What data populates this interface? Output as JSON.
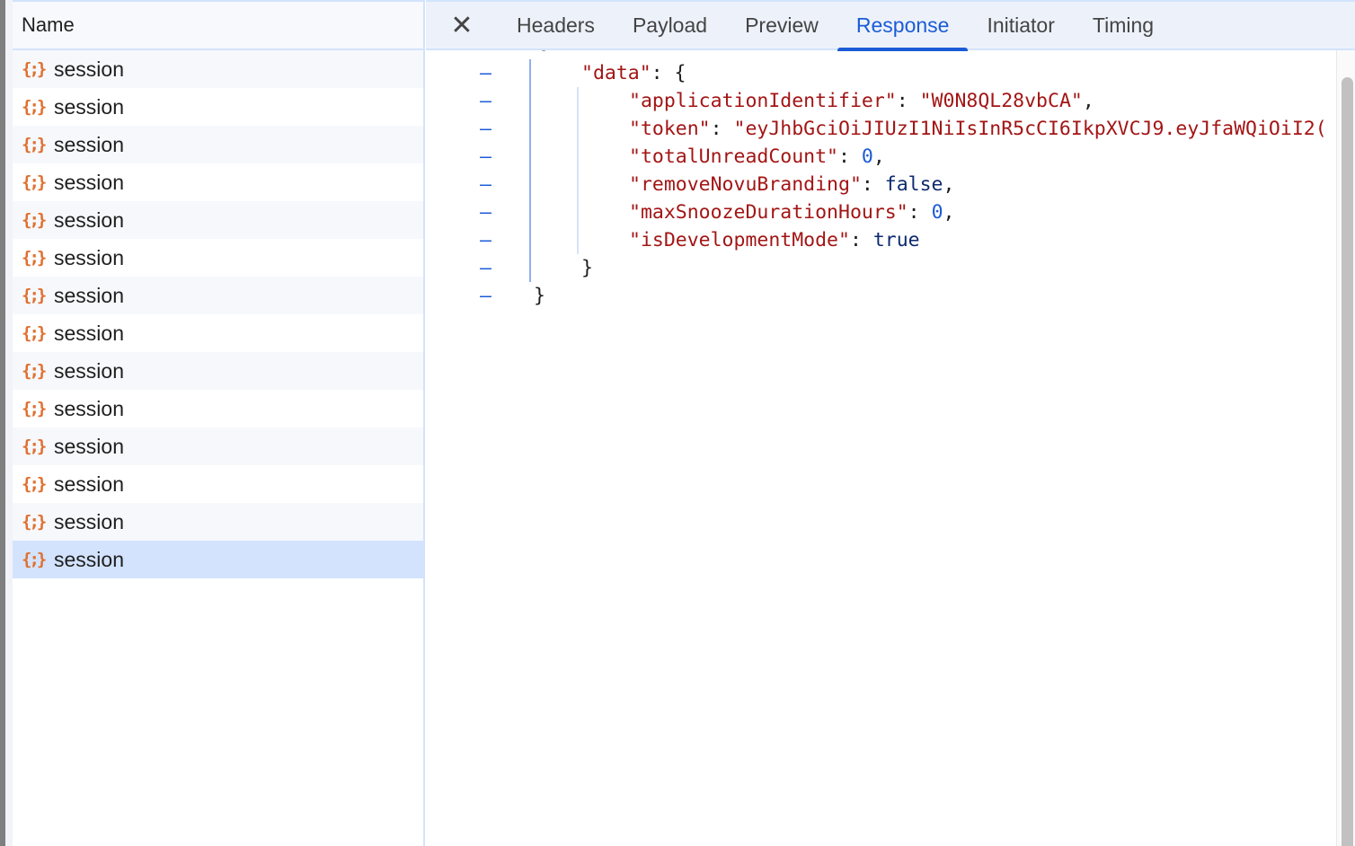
{
  "name_header": "Name",
  "requests": [
    {
      "name": "session"
    },
    {
      "name": "session"
    },
    {
      "name": "session"
    },
    {
      "name": "session"
    },
    {
      "name": "session"
    },
    {
      "name": "session"
    },
    {
      "name": "session"
    },
    {
      "name": "session"
    },
    {
      "name": "session"
    },
    {
      "name": "session"
    },
    {
      "name": "session"
    },
    {
      "name": "session"
    },
    {
      "name": "session"
    },
    {
      "name": "session",
      "selected": true
    }
  ],
  "tabs": [
    "Headers",
    "Payload",
    "Preview",
    "Response",
    "Initiator",
    "Timing"
  ],
  "active_tab": "Response",
  "response": {
    "open_brace": "{",
    "data_key": "\"data\"",
    "fields": [
      {
        "key": "\"applicationIdentifier\"",
        "value": "\"W0N8QL28vbCA\"",
        "type": "s",
        "comma": ","
      },
      {
        "key": "\"token\"",
        "value": "\"eyJhbGciOiJIUzI1NiIsInR5cCI6IkpXVCJ9.eyJfaWQiOiI2(",
        "type": "s",
        "comma": ""
      },
      {
        "key": "\"totalUnreadCount\"",
        "value": "0",
        "type": "n",
        "comma": ","
      },
      {
        "key": "\"removeNovuBranding\"",
        "value": "false",
        "type": "b",
        "comma": ","
      },
      {
        "key": "\"maxSnoozeDurationHours\"",
        "value": "0",
        "type": "n",
        "comma": ","
      },
      {
        "key": "\"isDevelopmentMode\"",
        "value": "true",
        "type": "b",
        "comma": ""
      }
    ],
    "close_inner": "}",
    "close_outer": "}"
  },
  "colors": {
    "accent": "#1b5bd6",
    "json_key": "#a31515",
    "icon": "#e0702f",
    "selected_row": "#d3e3fd"
  }
}
